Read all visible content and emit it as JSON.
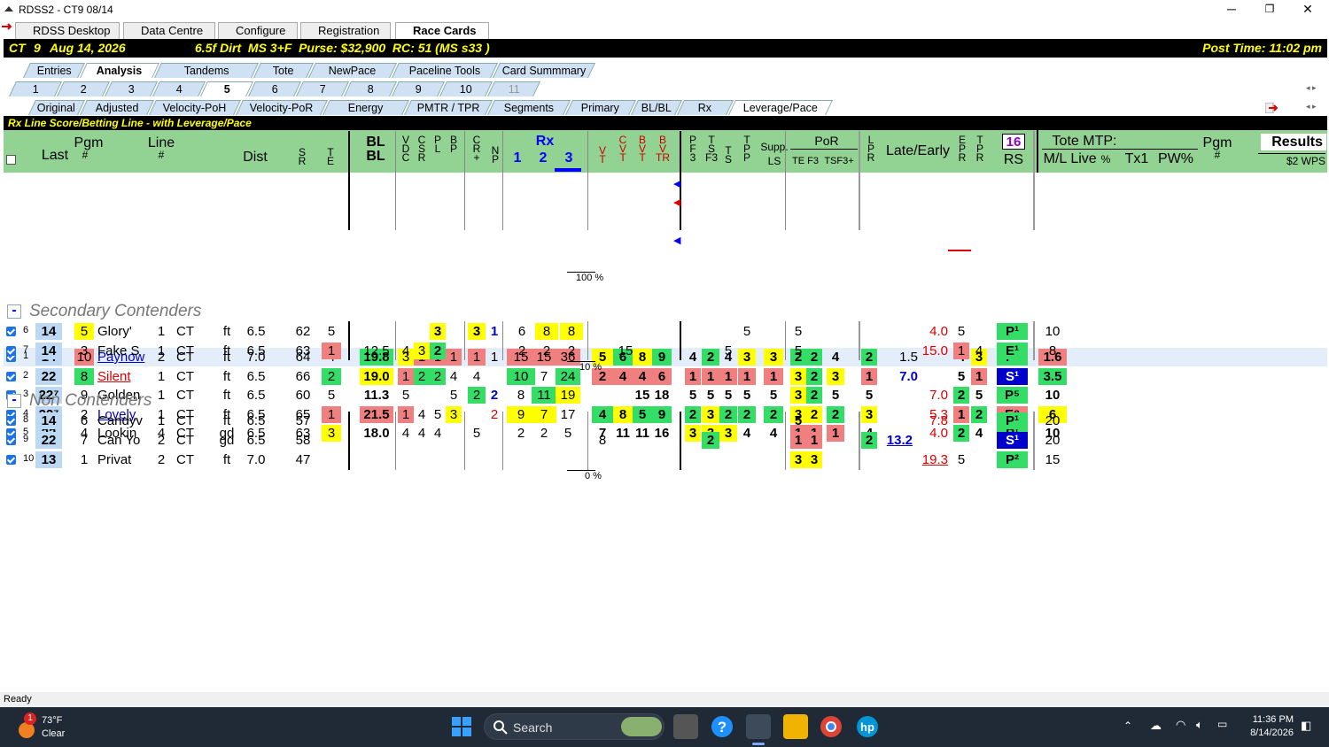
{
  "window": {
    "title": "RDSS2 - CT9  08/14",
    "min": "─",
    "max": "❐",
    "close": "✕"
  },
  "main_tabs": [
    {
      "label": "RDSS Desktop"
    },
    {
      "label": "Data Centre"
    },
    {
      "label": "Configure"
    },
    {
      "label": "Registration"
    },
    {
      "label": "Race Cards"
    }
  ],
  "race_info": {
    "track": "CT",
    "race": "9",
    "date": "Aug 14, 2026",
    "conditions": "6.5f Dirt  MS 3+F  Purse: $32,900  RC: 51 (MS s33 )",
    "post_time": "Post Time: 11:02 pm"
  },
  "view_tabs": [
    "Entries",
    "Analysis",
    "Tandems",
    "Tote",
    "NewPace",
    "Paceline Tools",
    "Card Summmary"
  ],
  "race_tabs": [
    "1",
    "2",
    "3",
    "4",
    "5",
    "6",
    "7",
    "8",
    "9",
    "10",
    "11"
  ],
  "analysis_tabs": [
    "Original",
    "Adjusted",
    "Velocity-PoH",
    "Velocity-PoR",
    "Energy",
    "PMTR / TPR",
    "Segments",
    "Primary",
    "BL/BL",
    "Rx",
    "Leverage/Pace"
  ],
  "subtitle": "Rx Line Score/Betting Line - with Leverage/Pace",
  "headers": {
    "last": "Last",
    "pgm": "Pgm",
    "pgm_hash": "#",
    "line": "Line",
    "line_hash": "#",
    "dist": "Dist",
    "sr": "S\nR",
    "te": "T\nE",
    "blbl": "BL\nBL",
    "vdc": "V\nD\nC",
    "csr": "C\nS\nR",
    "pl": "P\nL",
    "bp": "B\nP",
    "crplus": "C\nR\n+",
    "np": "N\nP",
    "rx": "Rx",
    "rx1": "1",
    "rx2": "2",
    "rx3": "3",
    "vt": "V\nT",
    "cvt": "C\nV\nT",
    "bvt": "B\nV\nT",
    "bvtr": "B\nV\nTR",
    "pf3": "P\nF\n3",
    "tsf3": "T\nS\nF3",
    "ts": "T\nS",
    "tpp": "T\nP\nP",
    "supp": "Supp.",
    "ls": "LS",
    "por": "PoR",
    "te_f3": "TE F3",
    "tsf3plus": "TSF3+",
    "lpr": "L\nP\nR",
    "late_early": "Late/Early",
    "epr": "E\nP\nR",
    "tpr": "T\nP\nR",
    "rs_num": "16",
    "rs": "RS",
    "tote_mtp": "Tote MTP:",
    "ml": "M/L",
    "live": "Live",
    "pct": "%",
    "tx1": "Tx1",
    "pw": "PW%",
    "pgm2": "Pgm",
    "pgm2_hash": "#",
    "results": "Results",
    "wps": "$2 WPS"
  },
  "rows": [
    {
      "n": "1",
      "last": "14",
      "pgm": "10",
      "name": "Paynow",
      "line": "2",
      "trk": "CT",
      "surf": "ft",
      "dist": "7.0",
      "sr": "64",
      "te": "4",
      "blbl": "19.8",
      "c1": "3",
      "c2": "1",
      "c3": "1",
      "c4": "1",
      "cr": "1",
      "np": "1",
      "rx1": "15",
      "rx2": "15",
      "rx3": "36",
      "vt": "5",
      "cvt": "6",
      "bvt": "8",
      "bvtr": "9",
      "pf": "4",
      "ts1": "2",
      "ts2": "4",
      "tp": "3",
      "ls": "3",
      "pa": "2",
      "pb": "2",
      "pc": "4",
      "lpr": "2",
      "le": "1.5",
      "le2": "",
      "epr": "4",
      "tpr": "3",
      "rs": "P³",
      "ml": "1.6"
    },
    {
      "n": "2",
      "last": "22",
      "pgm": "8",
      "name": "Silent",
      "line": "1",
      "trk": "CT",
      "surf": "ft",
      "dist": "6.5",
      "sr": "66",
      "te": "2",
      "blbl": "19.0",
      "c1": "1",
      "c2": "2",
      "c3": "2",
      "c4": "4",
      "cr": "4",
      "np": "",
      "rx1": "10",
      "rx2": "7",
      "rx3": "24",
      "vt": "2",
      "cvt": "4",
      "bvt": "4",
      "bvtr": "6",
      "pf": "1",
      "ts1": "1",
      "ts2": "1",
      "tp": "1",
      "ls": "1",
      "pa": "3",
      "pb": "2",
      "pc": "3",
      "lpr": "1",
      "le": "7.0",
      "le2": "",
      "epr": "5",
      "tpr": "1",
      "rs": "S¹",
      "ml": "3.5"
    },
    {
      "n": "3",
      "last": "22⁷",
      "pgm": "9",
      "name": "Golden",
      "line": "1",
      "trk": "CT",
      "surf": "ft",
      "dist": "6.5",
      "sr": "60",
      "te": "5",
      "blbl": "11.3",
      "c1": "5",
      "c2": "",
      "c3": "",
      "c4": "5",
      "cr": "2",
      "np": "2",
      "rx1": "8",
      "rx2": "11",
      "rx3": "19",
      "vt": "",
      "cvt": "",
      "bvt": "15",
      "bvtr": "18",
      "pf": "5",
      "ts1": "5",
      "ts2": "5",
      "tp": "5",
      "ls": "5",
      "pa": "3",
      "pb": "2",
      "pc": "5",
      "lpr": "5",
      "le": "",
      "le2": "7.0",
      "epr": "2",
      "tpr": "5",
      "rs": "P⁵",
      "ml": "10"
    },
    {
      "n": "4",
      "last": "22⁷",
      "pgm": "2",
      "name": "Lovely",
      "line": "1",
      "trk": "CT",
      "surf": "ft",
      "dist": "6.5",
      "sr": "65",
      "te": "1",
      "blbl": "21.5",
      "c1": "1",
      "c2": "4",
      "c3": "5",
      "c4": "3",
      "cr": "",
      "np": "2",
      "rx1": "9",
      "rx2": "7",
      "rx3": "17",
      "vt": "4",
      "cvt": "8",
      "bvt": "5",
      "bvtr": "9",
      "pf": "2",
      "ts1": "3",
      "ts2": "2",
      "tp": "2",
      "ls": "2",
      "pa": "3",
      "pb": "2",
      "pc": "2",
      "lpr": "3",
      "le": "",
      "le2": "5.3",
      "epr": "1",
      "tpr": "2",
      "rs": "E⁸",
      "ml": "6"
    },
    {
      "n": "5",
      "last": "22",
      "pgm": "4",
      "name": "Lookin",
      "line": "4",
      "trk": "CT",
      "surf": "gd",
      "dist": "6.5",
      "sr": "63",
      "te": "3",
      "blbl": "18.0",
      "c1": "4",
      "c2": "4",
      "c3": "4",
      "c4": "",
      "cr": "5",
      "np": "",
      "rx1": "2",
      "rx2": "2",
      "rx3": "5",
      "vt": "7",
      "cvt": "11",
      "bvt": "11",
      "bvtr": "16",
      "pf": "3",
      "ts1": "3",
      "ts2": "3",
      "tp": "4",
      "ls": "4",
      "pa": "1",
      "pb": "1",
      "pc": "1",
      "lpr": "4",
      "le": "",
      "le2": "4.0",
      "epr": "2",
      "tpr": "4",
      "rs": "P¹",
      "ml": "10"
    }
  ],
  "group1_pct": "100 %",
  "secondary": {
    "title": "Secondary Contenders",
    "toggle": "-",
    "pct": "10 %"
  },
  "rows2": [
    {
      "n": "6",
      "last": "14",
      "pgm": "5",
      "name": "Glory'",
      "line": "1",
      "trk": "CT",
      "surf": "ft",
      "dist": "6.5",
      "sr": "62",
      "te": "5",
      "blbl": "",
      "c4": "3",
      "cr": "3",
      "np": "1",
      "rx1": "6",
      "rx2": "8",
      "rx3": "8",
      "vt": "",
      "tp": "5",
      "pa": "5",
      "le2": "4.0",
      "epr": "5",
      "tpr": "",
      "rs": "P¹",
      "ml": "10"
    },
    {
      "n": "7",
      "last": "14",
      "pgm": "3",
      "name": "Fake S",
      "line": "1",
      "trk": "CT",
      "surf": "ft",
      "dist": "6.5",
      "sr": "63",
      "te": "1",
      "blbl": "12.5",
      "c1": "4",
      "c2": "3",
      "c4": "2",
      "rx1": "2",
      "rx2": "2",
      "rx3": "2",
      "vt": "15",
      "ts2": "5",
      "pa": "5",
      "le2": "15.0",
      "epr": "1",
      "tpr": "4",
      "rs": "E¹",
      "ml": "8"
    }
  ],
  "non": {
    "title": "Non Contenders",
    "toggle": "-",
    "pct": "0 %"
  },
  "rows3": [
    {
      "n": "8",
      "last": "14",
      "pgm": "6",
      "name": "Candyv",
      "line": "1",
      "trk": "CT",
      "surf": "ft",
      "dist": "6.5",
      "sr": "57",
      "pa": "5",
      "le2": "7.8",
      "rs": "P¹",
      "ml": "20"
    },
    {
      "n": "9",
      "last": "22",
      "pgm": "7",
      "name": "Can Yo",
      "line": "2",
      "trk": "CT",
      "surf": "gd",
      "dist": "6.5",
      "sr": "58",
      "vt": "8",
      "ts1": "2",
      "pa": "1",
      "pb": "1",
      "lpr": "2",
      "le": "13.2",
      "rs": "S¹",
      "ml": "20"
    },
    {
      "n": "10",
      "last": "13",
      "pgm": "1",
      "name": "Privat",
      "line": "2",
      "trk": "CT",
      "surf": "ft",
      "dist": "7.0",
      "sr": "47",
      "pa": "3",
      "pb": "3",
      "le2": "19.3",
      "epr": "5",
      "rs": "P²",
      "ml": "15"
    }
  ],
  "status": "Ready",
  "taskbar": {
    "temp": "73°F",
    "weather": "Clear",
    "badge": "1",
    "search": "Search",
    "time": "11:36 PM",
    "date": "8/14/2026"
  }
}
